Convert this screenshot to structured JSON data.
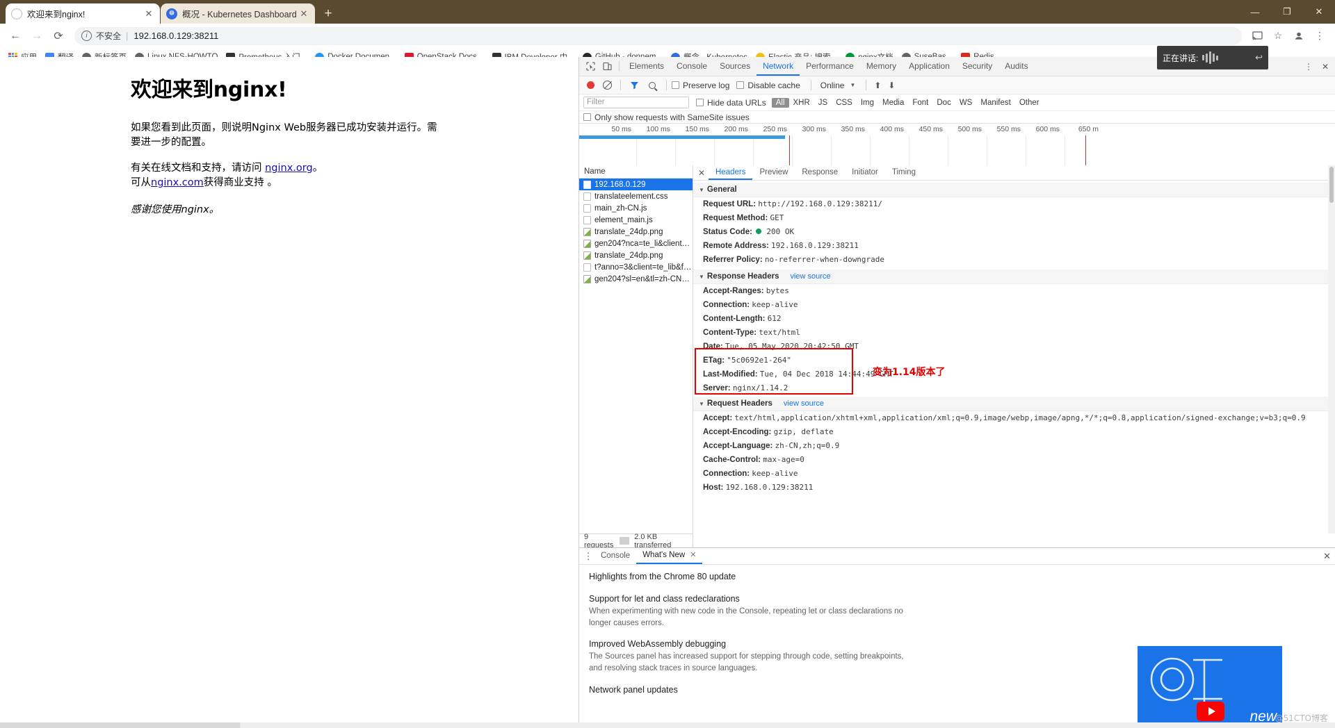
{
  "browser": {
    "tabs": [
      {
        "title": "欢迎来到nginx!",
        "favicon": "globe-icon",
        "active": true,
        "close": "✕"
      },
      {
        "title": "概况 - Kubernetes Dashboard",
        "favicon": "kubernetes-icon",
        "active": false,
        "close": "✕"
      }
    ],
    "new_tab_label": "+",
    "window_controls": {
      "minimize": "—",
      "maximize": "❐",
      "close": "✕"
    },
    "nav": {
      "back": "←",
      "forward": "→",
      "reload": "⟳"
    },
    "omnibox": {
      "security_label": "不安全",
      "separator": "|",
      "url": "192.168.0.129:38211",
      "info_icon": "info-icon"
    },
    "toolbar_icons": {
      "cast": "cast-icon",
      "star": "star-icon",
      "profile": "profile-icon",
      "menu": "kebab-menu-icon"
    },
    "bookmarks": [
      {
        "label": "应用",
        "icon": "apps-grid-icon",
        "color": "#4285f4"
      },
      {
        "label": "翻译",
        "icon": "translate-icon",
        "color": "#4285f4"
      },
      {
        "label": "新标签页",
        "icon": "globe-icon",
        "color": "#5f6368"
      },
      {
        "label": "Linux NFS-HOWTO",
        "icon": "globe-icon",
        "color": "#5f6368"
      },
      {
        "label": "Prometheus 入门...",
        "icon": "prometheus-icon",
        "color": "#333333"
      },
      {
        "label": "Docker Documen...",
        "icon": "docker-icon",
        "color": "#2496ed"
      },
      {
        "label": "OpenStack Docs...",
        "icon": "openstack-icon",
        "color": "#da1a32"
      },
      {
        "label": "IBM Developer 中...",
        "icon": "ibm-icon",
        "color": "#333333"
      },
      {
        "label": "GitHub - donnem...",
        "icon": "github-icon",
        "color": "#24292e"
      },
      {
        "label": "概念 - Kubernetes",
        "icon": "kubernetes-icon",
        "color": "#326ce5"
      },
      {
        "label": "Elastic 产品: 搜索...",
        "icon": "elastic-icon",
        "color": "#f0bf1a"
      },
      {
        "label": "nginx文档",
        "icon": "nginx-icon",
        "color": "#009639"
      },
      {
        "label": "SuseBas...",
        "icon": "globe-icon",
        "color": "#5f6368"
      },
      {
        "label": "Redis",
        "icon": "redis-icon",
        "color": "#d82c20"
      }
    ]
  },
  "page": {
    "heading": "欢迎来到nginx!",
    "paragraph1": "如果您看到此页面，则说明Nginx Web服务器已成功安装并运行。需要进一步的配置。",
    "paragraph2_prefix": "有关在线文档和支持，请访问 ",
    "paragraph2_link": "nginx.org",
    "paragraph2_suffix": "。",
    "paragraph3_prefix": "可从",
    "paragraph3_link": "nginx.com",
    "paragraph3_suffix": "获得商业支持 。",
    "thanks": "感谢您使用nginx。"
  },
  "devtools": {
    "left_icons": {
      "inspect": "inspect-cursor-icon",
      "device": "device-toolbar-icon"
    },
    "panels": [
      "Elements",
      "Console",
      "Sources",
      "Network",
      "Performance",
      "Memory",
      "Application",
      "Security",
      "Audits"
    ],
    "active_panel": "Network",
    "right_icons": {
      "settings": "kebab-menu-icon",
      "close": "close-icon"
    },
    "controls": {
      "record": "record-icon",
      "clear": "clear-icon",
      "filter": "funnel-icon",
      "search": "search-icon",
      "preserve_log": "Preserve log",
      "disable_cache": "Disable cache",
      "throttle": "Online",
      "throttle_caret": "▼",
      "import": "import-har-icon",
      "export": "export-har-icon"
    },
    "filterbar": {
      "placeholder": "Filter",
      "hide_data_urls": "Hide data URLs",
      "types": [
        "All",
        "XHR",
        "JS",
        "CSS",
        "Img",
        "Media",
        "Font",
        "Doc",
        "WS",
        "Manifest",
        "Other"
      ],
      "active_type": "All"
    },
    "samesite_label": "Only show requests with SameSite issues",
    "timeline_ticks": [
      "50 ms",
      "100 ms",
      "150 ms",
      "200 ms",
      "250 ms",
      "300 ms",
      "350 ms",
      "400 ms",
      "450 ms",
      "500 ms",
      "550 ms",
      "600 ms",
      "650 m"
    ],
    "requests": {
      "column_header": "Name",
      "rows": [
        {
          "name": "192.168.0.129",
          "icon": "document-icon",
          "selected": true
        },
        {
          "name": "translateelement.css",
          "icon": "stylesheet-icon",
          "selected": false
        },
        {
          "name": "main_zh-CN.js",
          "icon": "script-icon",
          "selected": false
        },
        {
          "name": "element_main.js",
          "icon": "script-icon",
          "selected": false
        },
        {
          "name": "translate_24dp.png",
          "icon": "image-icon",
          "selected": false
        },
        {
          "name": "gen204?nca=te_li&client=te_li...",
          "icon": "image-icon",
          "selected": false
        },
        {
          "name": "translate_24dp.png",
          "icon": "image-icon",
          "selected": false
        },
        {
          "name": "t?anno=3&client=te_lib&form...",
          "icon": "script-icon",
          "selected": false
        },
        {
          "name": "gen204?sl=en&tl=zh-CN&tex...",
          "icon": "image-icon",
          "selected": false
        }
      ]
    },
    "summary": {
      "requests": "9 requests",
      "transferred": "2.0 KB transferred"
    },
    "detail_tabs": [
      "Headers",
      "Preview",
      "Response",
      "Initiator",
      "Timing"
    ],
    "detail_active": "Headers",
    "detail_close": "✕",
    "general": {
      "section": "General",
      "items": [
        {
          "key": "Request URL:",
          "value": "http://192.168.0.129:38211/"
        },
        {
          "key": "Request Method:",
          "value": "GET"
        },
        {
          "key": "Status Code:",
          "value": "200 OK",
          "has_dot": true
        },
        {
          "key": "Remote Address:",
          "value": "192.168.0.129:38211"
        },
        {
          "key": "Referrer Policy:",
          "value": "no-referrer-when-downgrade"
        }
      ]
    },
    "response_headers": {
      "section": "Response Headers",
      "view_source": "view source",
      "items": [
        {
          "key": "Accept-Ranges:",
          "value": "bytes"
        },
        {
          "key": "Connection:",
          "value": "keep-alive"
        },
        {
          "key": "Content-Length:",
          "value": "612"
        },
        {
          "key": "Content-Type:",
          "value": "text/html"
        },
        {
          "key": "Date:",
          "value": "Tue, 05 May 2020 20:42:50 GMT"
        },
        {
          "key": "ETag:",
          "value": "\"5c0692e1-264\""
        },
        {
          "key": "Last-Modified:",
          "value": "Tue, 04 Dec 2018 14:44:49 GMT"
        },
        {
          "key": "Server:",
          "value": "nginx/1.14.2"
        }
      ]
    },
    "request_headers": {
      "section": "Request Headers",
      "view_source": "view source",
      "items": [
        {
          "key": "Accept:",
          "value": "text/html,application/xhtml+xml,application/xml;q=0.9,image/webp,image/apng,*/*;q=0.8,application/signed-exchange;v=b3;q=0.9"
        },
        {
          "key": "Accept-Encoding:",
          "value": "gzip, deflate"
        },
        {
          "key": "Accept-Language:",
          "value": "zh-CN,zh;q=0.9"
        },
        {
          "key": "Cache-Control:",
          "value": "max-age=0"
        },
        {
          "key": "Connection:",
          "value": "keep-alive"
        },
        {
          "key": "Host:",
          "value": "192.168.0.129:38211"
        }
      ]
    },
    "annotation": {
      "text": "变为1.14版本了",
      "color": "#e60000"
    }
  },
  "drawer": {
    "tabs": [
      {
        "label": "Console",
        "selected": false
      },
      {
        "label": "What's New",
        "selected": true,
        "close": "✕"
      }
    ],
    "kebab": "kebab-menu-icon",
    "close": "✕",
    "heading": "Highlights from the Chrome 80 update",
    "items": [
      {
        "title": "Support for let and class redeclarations",
        "desc": "When experimenting with new code in the Console, repeating let or class declarations no longer causes errors."
      },
      {
        "title": "Improved WebAssembly debugging",
        "desc": "The Sources panel has increased support for stepping through code, setting breakpoints, and resolving stack traces in source languages."
      },
      {
        "title": "Network panel updates",
        "desc": ""
      }
    ],
    "video_label": "new"
  },
  "overlays": {
    "speaking": {
      "text": "正在讲话:",
      "reply_icon": "reply-icon"
    },
    "watermark": "@51CTO博客"
  }
}
